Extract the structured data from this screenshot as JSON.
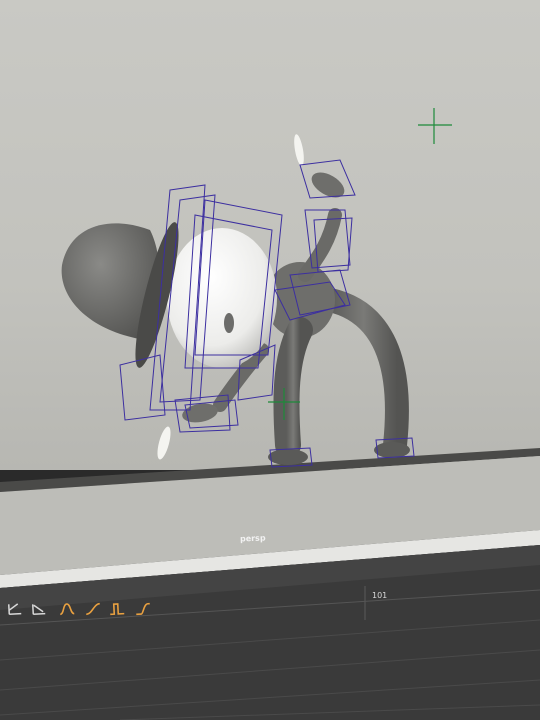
{
  "viewport": {
    "camera_label": "persp"
  },
  "timeline": {
    "frame_label": "101"
  },
  "toolbar": {
    "icons": [
      {
        "name": "key-tangent-icon"
      },
      {
        "name": "key-tangent-alt-icon"
      },
      {
        "name": "spline-tangent-icon"
      },
      {
        "name": "linear-tangent-icon"
      },
      {
        "name": "stepped-tangent-icon"
      },
      {
        "name": "flat-tangent-icon"
      }
    ]
  },
  "colors": {
    "viewport_bg": "#c8c8c3",
    "character_grey": "#6b6b69",
    "head_white": "#f2f2f0",
    "rig_box": "#3c2fa0",
    "locator": "#1d8a3a",
    "icon_orange": "#e8a040",
    "panel_dark": "#3a3a3a"
  }
}
